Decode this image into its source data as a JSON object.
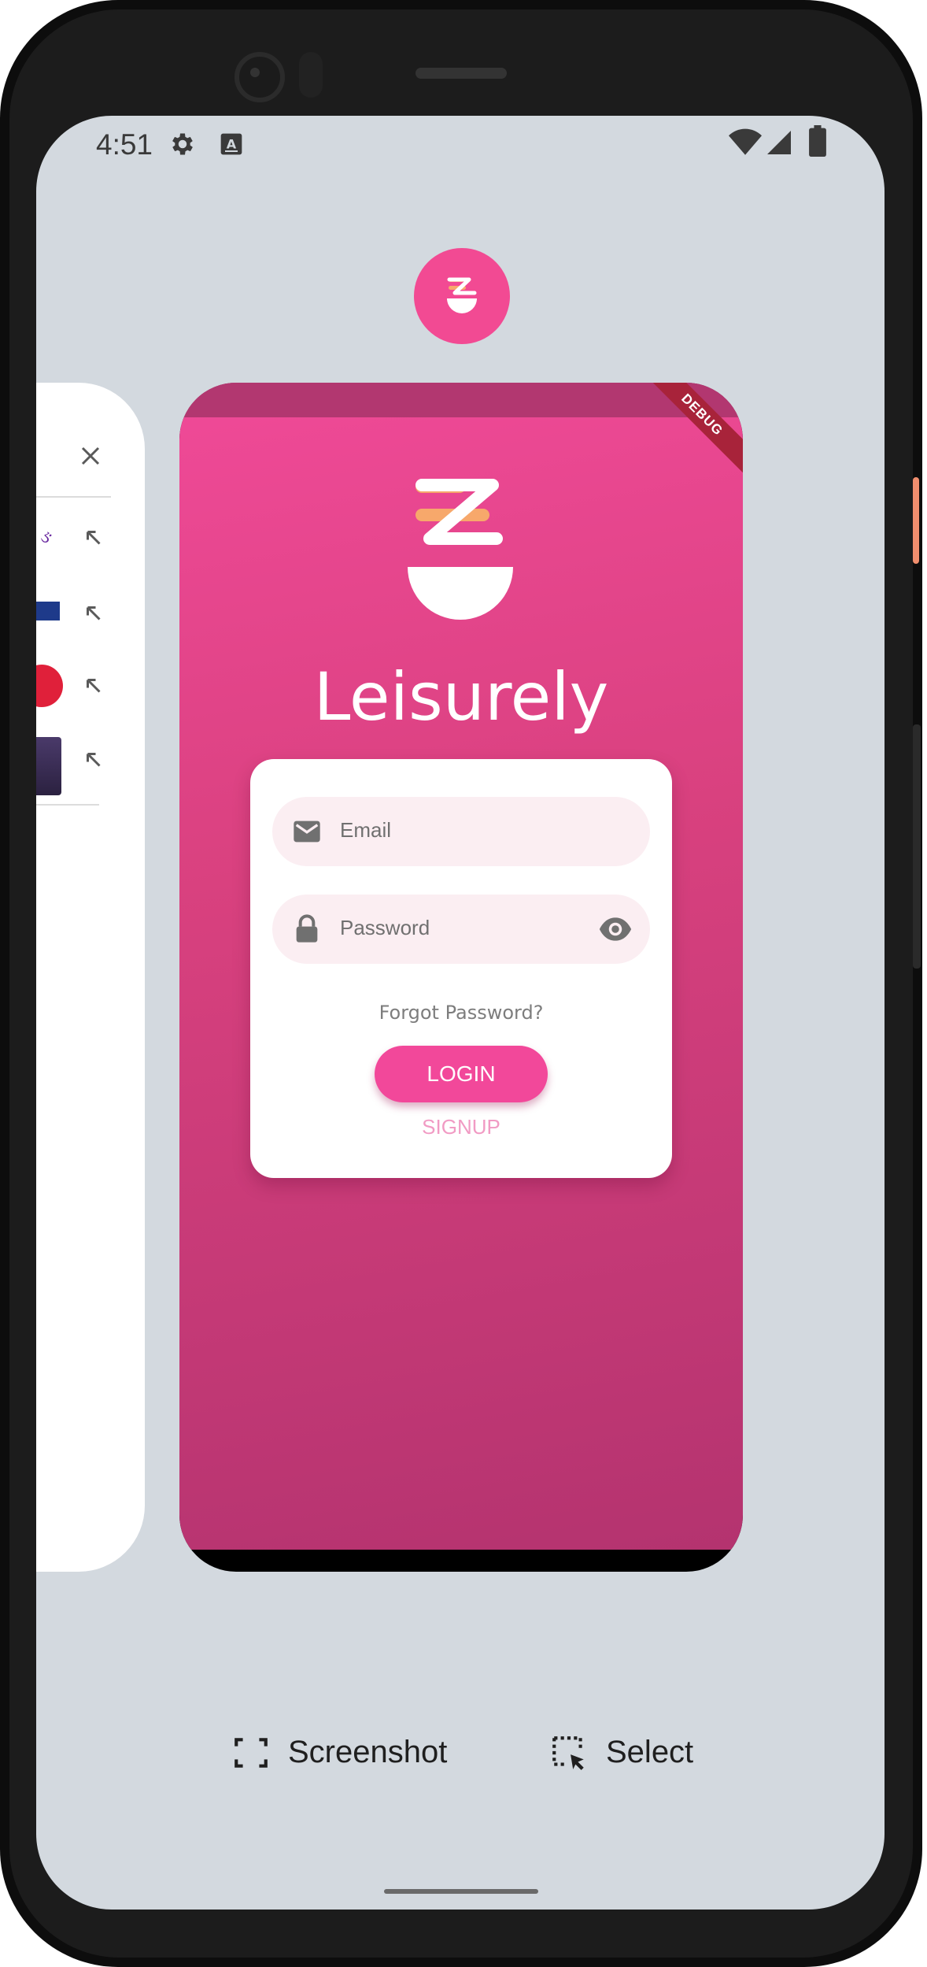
{
  "status_bar": {
    "time": "4:51",
    "icons": [
      "gear-icon",
      "keyboard-a-icon",
      "wifi-icon",
      "signal-icon",
      "battery-icon"
    ]
  },
  "recents": {
    "app_icon": "leisurely-logo-icon",
    "left_card": {
      "close_icon": "close-icon",
      "rows": [
        "arrow-up-left-icon",
        "arrow-up-left-icon",
        "arrow-up-left-icon",
        "arrow-up-left-icon"
      ]
    },
    "main_card": {
      "debug_label": "DEBUG",
      "brand_name": "Leisurely",
      "email_placeholder": "Email",
      "password_placeholder": "Password",
      "forgot_password": "Forgot Password?",
      "login_label": "LOGIN",
      "signup_label": "SIGNUP"
    }
  },
  "actions": {
    "screenshot_label": "Screenshot",
    "select_label": "Select"
  },
  "colors": {
    "accent_pink": "#f24a93",
    "screen_bg": "#d3d9df"
  }
}
